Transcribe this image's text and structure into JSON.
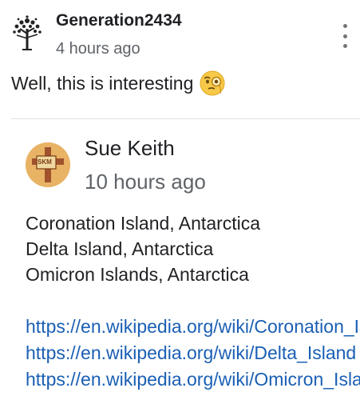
{
  "post": {
    "author": "Generation2434",
    "time": "4 hours ago",
    "text": "Well, this is interesting",
    "avatar_icon": "tree-icon",
    "emoji_icon": "face-with-monocle-emoji"
  },
  "shared_post": {
    "author": "Sue Keith",
    "time": "10 hours ago",
    "avatar_text": "SKM",
    "lines": [
      "Coronation Island, Antarctica",
      "Delta Island, Antarctica",
      "Omicron Islands, Antarctica"
    ],
    "links": [
      "https://en.wikipedia.org/wiki/Coronation_Island",
      "https://en.wikipedia.org/wiki/Delta_Island",
      "https://en.wikipedia.org/wiki/Omicron_Islands"
    ]
  },
  "colors": {
    "link": "#1a5fb4",
    "avatar_bg": "#e8b365",
    "secondary_text": "#5f6368"
  }
}
